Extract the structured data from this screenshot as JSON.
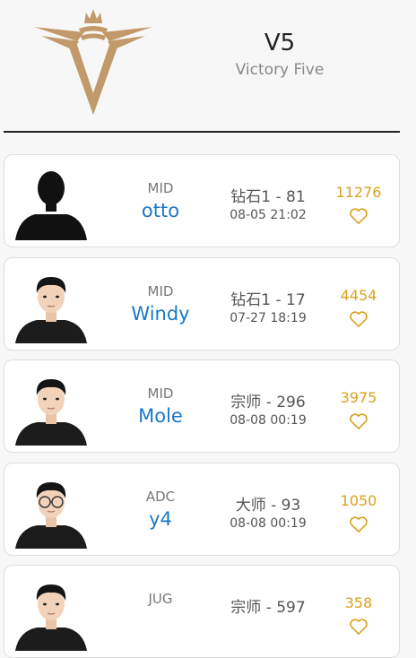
{
  "team": {
    "short_name": "V5",
    "full_name": "Victory Five"
  },
  "colors": {
    "accent_gold": "#d9a21f",
    "name_blue": "#1a78c8",
    "logo_gold": "#c2996a"
  },
  "players": [
    {
      "role": "MID",
      "name": "otto",
      "rank": "钻石1 - 81",
      "time": "08-05 21:02",
      "score": "11276",
      "avatar": "silhouette",
      "liked": false
    },
    {
      "role": "MID",
      "name": "Windy",
      "rank": "钻石1 - 17",
      "time": "07-27 18:19",
      "score": "4454",
      "avatar": "photo",
      "liked": false
    },
    {
      "role": "MID",
      "name": "Mole",
      "rank": "宗师 - 296",
      "time": "08-08 00:19",
      "score": "3975",
      "avatar": "photo",
      "liked": false
    },
    {
      "role": "ADC",
      "name": "y4",
      "rank": "大师 - 93",
      "time": "08-08 00:19",
      "score": "1050",
      "avatar": "photo-glasses",
      "liked": false
    },
    {
      "role": "JUG",
      "name": "",
      "rank": "宗师 - 597",
      "time": "",
      "score": "358",
      "avatar": "photo",
      "liked": false
    }
  ]
}
